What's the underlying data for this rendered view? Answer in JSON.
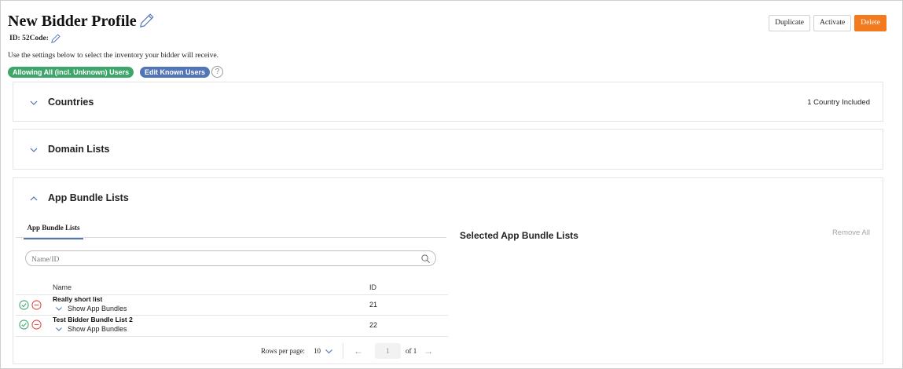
{
  "header": {
    "title": "New Bidder Profile",
    "id_line": "ID: 52Code:",
    "description": "Use the settings below to select the inventory your bidder will receive."
  },
  "badges": {
    "users": "Allowing All (incl. Unknown) Users",
    "edit_users": "Edit Known Users",
    "help": "?"
  },
  "actions": {
    "duplicate": "Duplicate",
    "activate": "Activate",
    "delete": "Delete"
  },
  "sections": {
    "countries": {
      "title": "Countries",
      "summary": "1 Country Included"
    },
    "domain_lists": {
      "title": "Domain Lists"
    },
    "app_bundle_lists": {
      "title": "App Bundle Lists"
    }
  },
  "app_bundle": {
    "tab_label": "App Bundle Lists",
    "search_placeholder": "Name/ID",
    "columns": {
      "name": "Name",
      "id": "ID"
    },
    "rows": [
      {
        "name": "Really short list",
        "toggle": "Show App Bundles",
        "id": "21"
      },
      {
        "name": "Test Bidder Bundle List 2",
        "toggle": "Show App Bundles",
        "id": "22"
      }
    ],
    "pagination": {
      "rows_per_page_label": "Rows per page:",
      "rows_per_page": "10",
      "page": "1",
      "of": "of 1"
    },
    "selected_title": "Selected App Bundle Lists",
    "remove_all": "Remove All"
  },
  "colors": {
    "accent_blue": "#5275b8",
    "green": "#3ea66b",
    "orange": "#f47a20",
    "red": "#e0483e"
  }
}
